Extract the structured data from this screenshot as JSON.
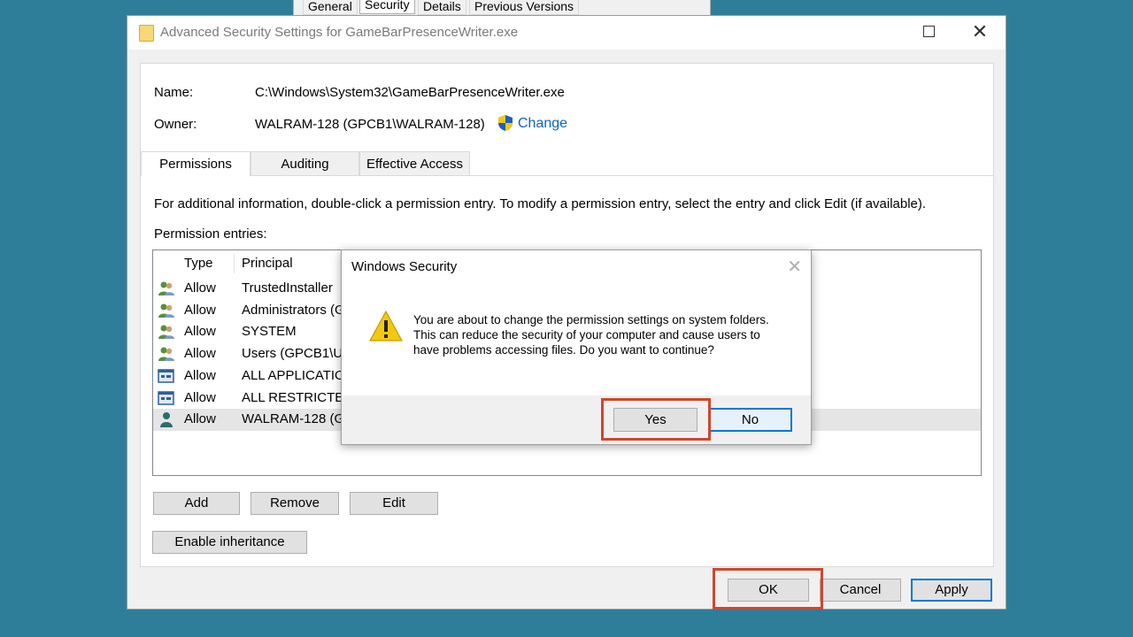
{
  "background_tabs": [
    "General",
    "Security",
    "Details",
    "Previous Versions"
  ],
  "window": {
    "title": "Advanced Security Settings for GameBarPresenceWriter.exe",
    "close_glyph": "✕"
  },
  "info": {
    "name_label": "Name:",
    "name_value": "C:\\Windows\\System32\\GameBarPresenceWriter.exe",
    "owner_label": "Owner:",
    "owner_value": "WALRAM-128 (GPCB1\\WALRAM-128)",
    "change_link": "Change"
  },
  "tabs": [
    "Permissions",
    "Auditing",
    "Effective Access"
  ],
  "instructions": "For additional information, double-click a permission entry. To modify a permission entry, select the entry and click Edit (if available).",
  "entries_label": "Permission entries:",
  "table": {
    "headers": [
      "Type",
      "Principal"
    ],
    "rows": [
      {
        "icon": "group-icon",
        "type": "Allow",
        "principal": "TrustedInstaller"
      },
      {
        "icon": "group-icon",
        "type": "Allow",
        "principal": "Administrators (G"
      },
      {
        "icon": "group-icon",
        "type": "Allow",
        "principal": "SYSTEM"
      },
      {
        "icon": "group-icon",
        "type": "Allow",
        "principal": "Users (GPCB1\\Us"
      },
      {
        "icon": "app-package-icon",
        "type": "Allow",
        "principal": "ALL APPLICATIO"
      },
      {
        "icon": "app-package-icon",
        "type": "Allow",
        "principal": "ALL RESTRICTED"
      },
      {
        "icon": "user-icon",
        "type": "Allow",
        "principal": "WALRAM-128 (G"
      }
    ]
  },
  "buttons": {
    "add": "Add",
    "remove": "Remove",
    "edit": "Edit",
    "enable_inheritance": "Enable inheritance",
    "ok": "OK",
    "cancel": "Cancel",
    "apply": "Apply"
  },
  "dialog": {
    "title": "Windows Security",
    "close_glyph": "✕",
    "message": "You are about to change the permission settings on system folders. This can reduce the security of your computer and cause users to have problems accessing files. Do you want to continue?",
    "yes": "Yes",
    "no": "No"
  },
  "colors": {
    "desktop": "#2f7e99",
    "link": "#0a63c9",
    "highlight": "#d2452b",
    "default_button_border": "#0078d7",
    "warning": "#f2c811"
  }
}
